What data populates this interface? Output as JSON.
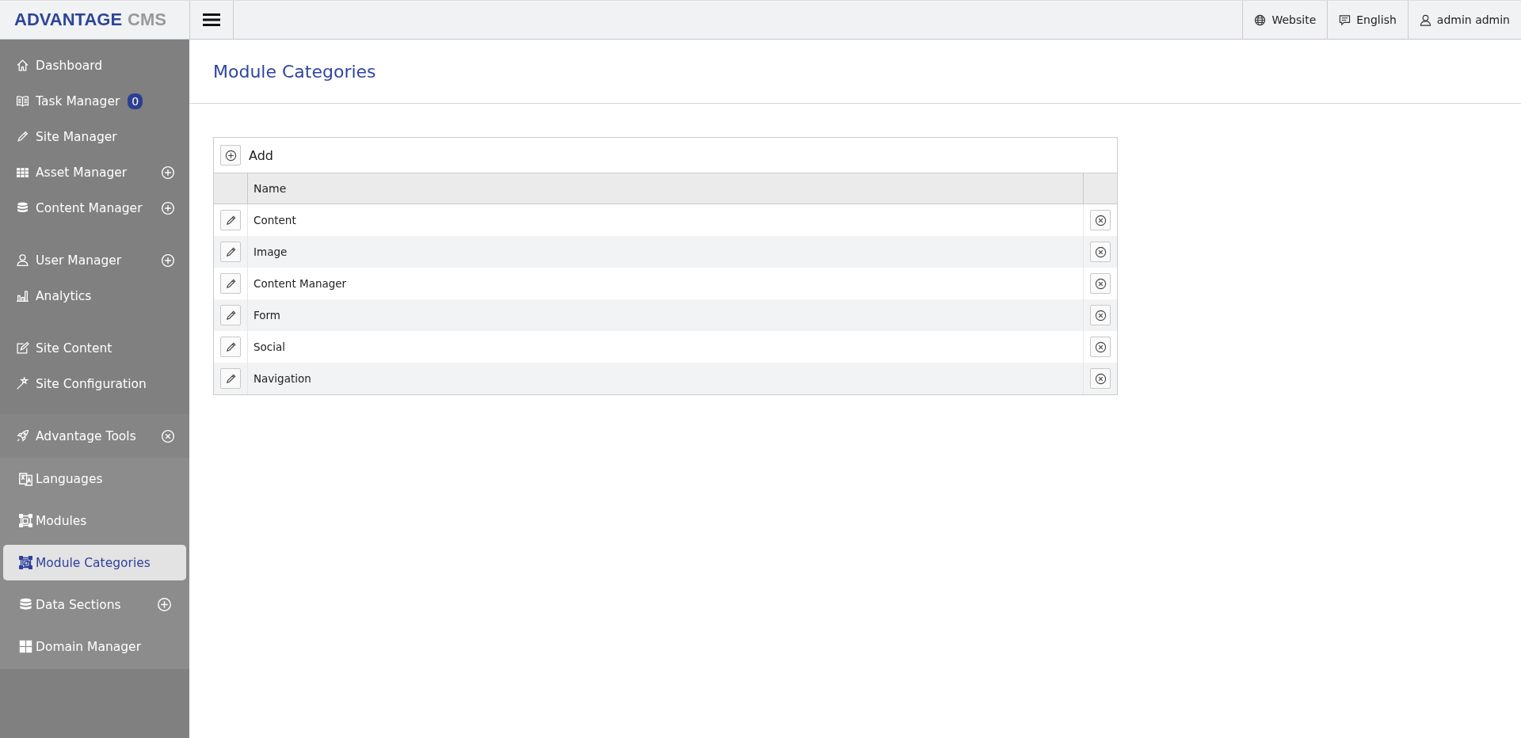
{
  "logo": {
    "brand": "ADVANTAGE",
    "suffix": "CMS"
  },
  "topbar": {
    "links": [
      {
        "label": "Website"
      },
      {
        "label": "English"
      },
      {
        "label": "admin admin"
      }
    ]
  },
  "sidebar": {
    "groups": [
      {
        "items": [
          {
            "label": "Dashboard"
          },
          {
            "label": "Task Manager",
            "badge": "0"
          },
          {
            "label": "Site Manager"
          },
          {
            "label": "Asset Manager",
            "expanded": false
          },
          {
            "label": "Content Manager",
            "expanded": false
          }
        ]
      },
      {
        "items": [
          {
            "label": "User Manager",
            "expanded": false
          },
          {
            "label": "Analytics"
          }
        ]
      },
      {
        "items": [
          {
            "label": "Site Content"
          },
          {
            "label": "Site Configuration"
          }
        ]
      },
      {
        "items": [
          {
            "label": "Advantage Tools",
            "expanded": true,
            "children": [
              {
                "label": "Languages",
                "selected": false
              },
              {
                "label": "Modules",
                "selected": false
              },
              {
                "label": "Module Categories",
                "selected": true
              },
              {
                "label": "Data Sections",
                "selected": false,
                "expanded": false
              },
              {
                "label": "Domain Manager",
                "selected": false
              }
            ]
          }
        ]
      }
    ]
  },
  "page": {
    "title": "Module Categories"
  },
  "table": {
    "add_label": "Add",
    "columns": [
      "Name"
    ],
    "rows": [
      {
        "name": "Content"
      },
      {
        "name": "Image"
      },
      {
        "name": "Content Manager"
      },
      {
        "name": "Form"
      },
      {
        "name": "Social"
      },
      {
        "name": "Navigation"
      }
    ]
  }
}
